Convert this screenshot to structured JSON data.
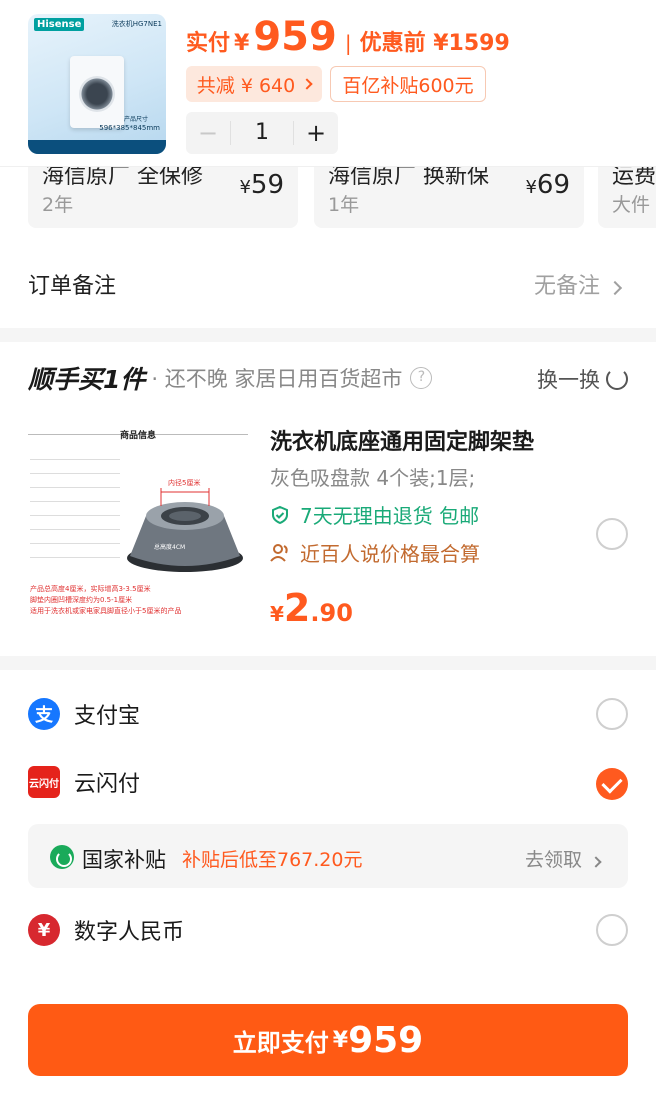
{
  "header": {
    "product_thumb": {
      "brand": "Hisense",
      "model": "洗衣机HG7NE1",
      "size_label": "产品尺寸",
      "size_value": "596*385*845mm"
    },
    "actual_label": "实付",
    "currency": "¥",
    "actual_price": "959",
    "separator": "|",
    "before_discount": "优惠前 ¥1599",
    "discount_chip": "共减 ¥ 640",
    "subsidy_chip": "百亿补贴600元",
    "quantity": "1",
    "minus": "−",
    "plus": "+"
  },
  "warranty": [
    {
      "title": "海信原厂 全保修",
      "sub": "2年",
      "currency": "¥",
      "price": "59"
    },
    {
      "title": "海信原厂 换新保",
      "sub": "1年",
      "currency": "¥",
      "price": "69"
    },
    {
      "title": "运费",
      "sub": "大件"
    }
  ],
  "order_note": {
    "label": "订单备注",
    "value": "无备注"
  },
  "addon": {
    "brand_title": "顺手买1件",
    "subtitle": "· 还不晚 家居日用百货超市",
    "help": "?",
    "swap_label": "换一换",
    "image_header": "商品信息",
    "image_label": "内径5厘米",
    "image_height": "总高度4CM",
    "image_foot": [
      "产品总高度4厘米，实际增高3-3.5厘米",
      "脚垫内圈凹槽深度约为0.5-1厘米",
      "适用于洗衣机或家电家具脚直径小于5厘米的产品"
    ],
    "name": "洗衣机底座通用固定脚架垫",
    "spec": "灰色吸盘款 4个装;1层;",
    "tag_return": "7天无理由退货  包邮",
    "tag_price": "近百人说价格最合算",
    "price_currency": "¥",
    "price_int": "2",
    "price_dec": ".90"
  },
  "payments": [
    {
      "name": "支付宝",
      "icon": "alipay-icon",
      "color": "#1677ff",
      "selected": false
    },
    {
      "name": "云闪付",
      "icon": "unionpay-icon",
      "color": "#e5231b",
      "selected": true
    },
    {
      "name": "数字人民币",
      "icon": "ecny-icon",
      "color": "#d7282f",
      "selected": false
    }
  ],
  "subsidy": {
    "title": "国家补贴",
    "hint": "补贴后低至767.20元",
    "action": "去领取"
  },
  "pay_button": {
    "label": "立即支付",
    "currency": "¥",
    "amount": "959"
  },
  "colors": {
    "accent": "#ff5a1f",
    "green": "#1aaa78"
  }
}
